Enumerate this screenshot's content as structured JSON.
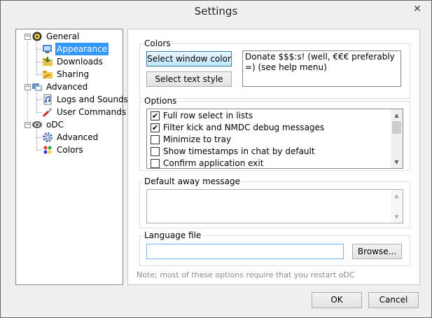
{
  "window": {
    "title": "Settings",
    "close_glyph": "✕"
  },
  "tree": {
    "items": [
      {
        "label": "General",
        "icon": "general-icon"
      },
      {
        "label": "Appearance",
        "icon": "appearance-icon",
        "selected": true
      },
      {
        "label": "Downloads",
        "icon": "downloads-icon"
      },
      {
        "label": "Sharing",
        "icon": "sharing-icon"
      },
      {
        "label": "Advanced",
        "icon": "advanced-icon"
      },
      {
        "label": "Logs and Sounds",
        "icon": "logs-icon"
      },
      {
        "label": "User Commands",
        "icon": "user-commands-icon"
      },
      {
        "label": "oDC",
        "icon": "odc-icon"
      },
      {
        "label": "Advanced",
        "icon": "gear-icon"
      },
      {
        "label": "Colors",
        "icon": "colors-icon"
      }
    ],
    "expander_glyph": "−"
  },
  "colors_group": {
    "label": "Colors",
    "select_window_color": "Select window color",
    "select_text_style": "Select text style",
    "preview_text": "Donate $$$:s! (well, €€€ preferably =) (see help menu)"
  },
  "options_group": {
    "label": "Options",
    "items": [
      {
        "label": "Full row select in lists",
        "checked": true
      },
      {
        "label": "Filter kick and NMDC debug messages",
        "checked": true
      },
      {
        "label": "Minimize to tray",
        "checked": false
      },
      {
        "label": "Show timestamps in chat by default",
        "checked": false
      },
      {
        "label": "Confirm application exit",
        "checked": false
      }
    ]
  },
  "away_group": {
    "label": "Default away message",
    "value": ""
  },
  "language_group": {
    "label": "Language file",
    "value": "",
    "browse_label": "Browse..."
  },
  "note": "Note; most of these options require that you restart oDC",
  "footer": {
    "ok_label": "OK",
    "cancel_label": "Cancel"
  },
  "colors": {
    "selection": "#3399ff",
    "focus_border": "#7eb4ea"
  }
}
